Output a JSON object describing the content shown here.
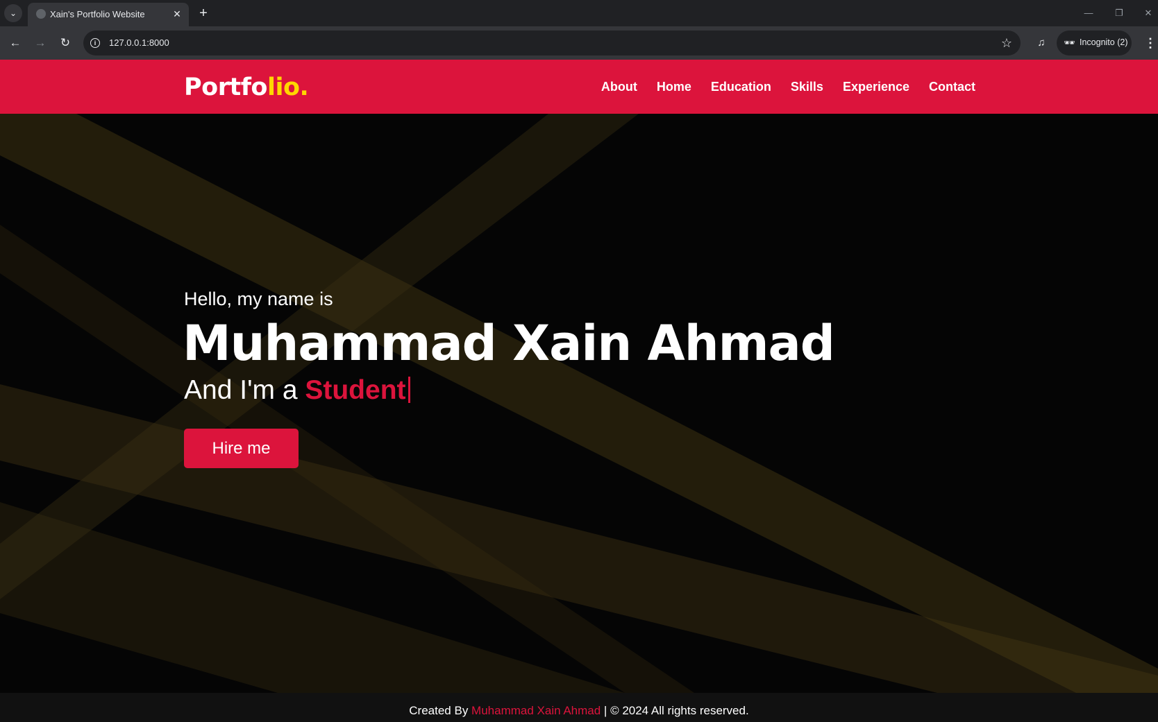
{
  "browser": {
    "tab_title": "Xain's Portfolio Website",
    "url": "127.0.0.1:8000",
    "incognito_label": "Incognito (2)",
    "icons": {
      "tab_list": "chevron-down-icon",
      "favicon": "globe-icon",
      "close": "close-icon",
      "new_tab": "plus-icon",
      "back": "back-arrow-icon",
      "forward": "forward-arrow-icon",
      "reload": "reload-icon",
      "site_info": "info-icon",
      "bookmark": "star-icon",
      "media": "media-control-icon",
      "incognito": "incognito-icon",
      "menu": "kebab-menu-icon"
    }
  },
  "site": {
    "logo_main": "Portfo",
    "logo_accent": "lio.",
    "nav": [
      "About",
      "Home",
      "Education",
      "Skills",
      "Experience",
      "Contact"
    ],
    "colors": {
      "primary": "#dc143c",
      "accent": "#ffd700",
      "background": "#050505"
    }
  },
  "hero": {
    "greeting": "Hello, my name is",
    "name": "Muhammad Xain Ahmad",
    "role_prefix": "And I'm a ",
    "role_word": "Student",
    "hire_button": "Hire me"
  },
  "footer": {
    "prefix": "Created By ",
    "author": "Muhammad Xain Ahmad",
    "suffix": " | © 2024 All rights reserved."
  }
}
